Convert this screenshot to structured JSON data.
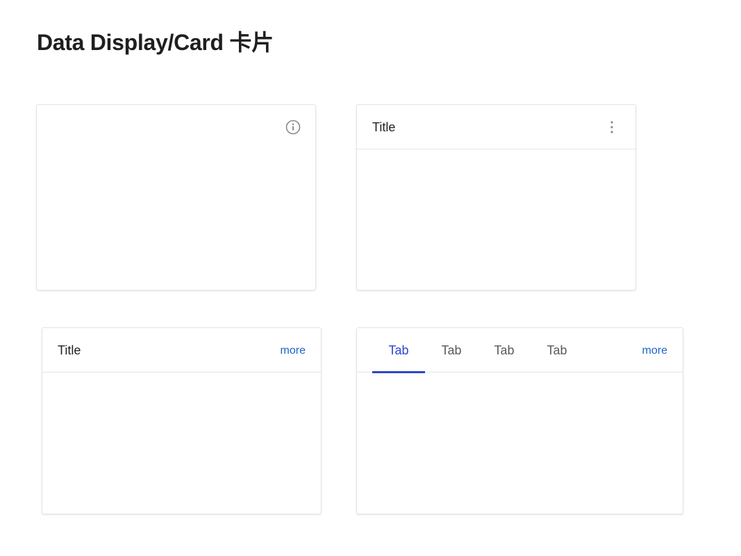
{
  "page": {
    "title": "Data Display/Card 卡片"
  },
  "cards": [
    {
      "id": "card-info",
      "icon": "info-circle-icon"
    },
    {
      "id": "card-title-kebab",
      "title": "Title",
      "icon": "kebab-vertical-icon"
    },
    {
      "id": "card-title-more",
      "title": "Title",
      "more_label": "more"
    },
    {
      "id": "card-tabs",
      "tabs": [
        {
          "label": "Tab",
          "active": true
        },
        {
          "label": "Tab",
          "active": false
        },
        {
          "label": "Tab",
          "active": false
        },
        {
          "label": "Tab",
          "active": false
        }
      ],
      "more_label": "more"
    }
  ],
  "colors": {
    "accent_blue": "#2b47c9",
    "link_blue": "#1d63c9",
    "border": "#e4e4e4",
    "icon_gray": "#8a8a8a"
  }
}
